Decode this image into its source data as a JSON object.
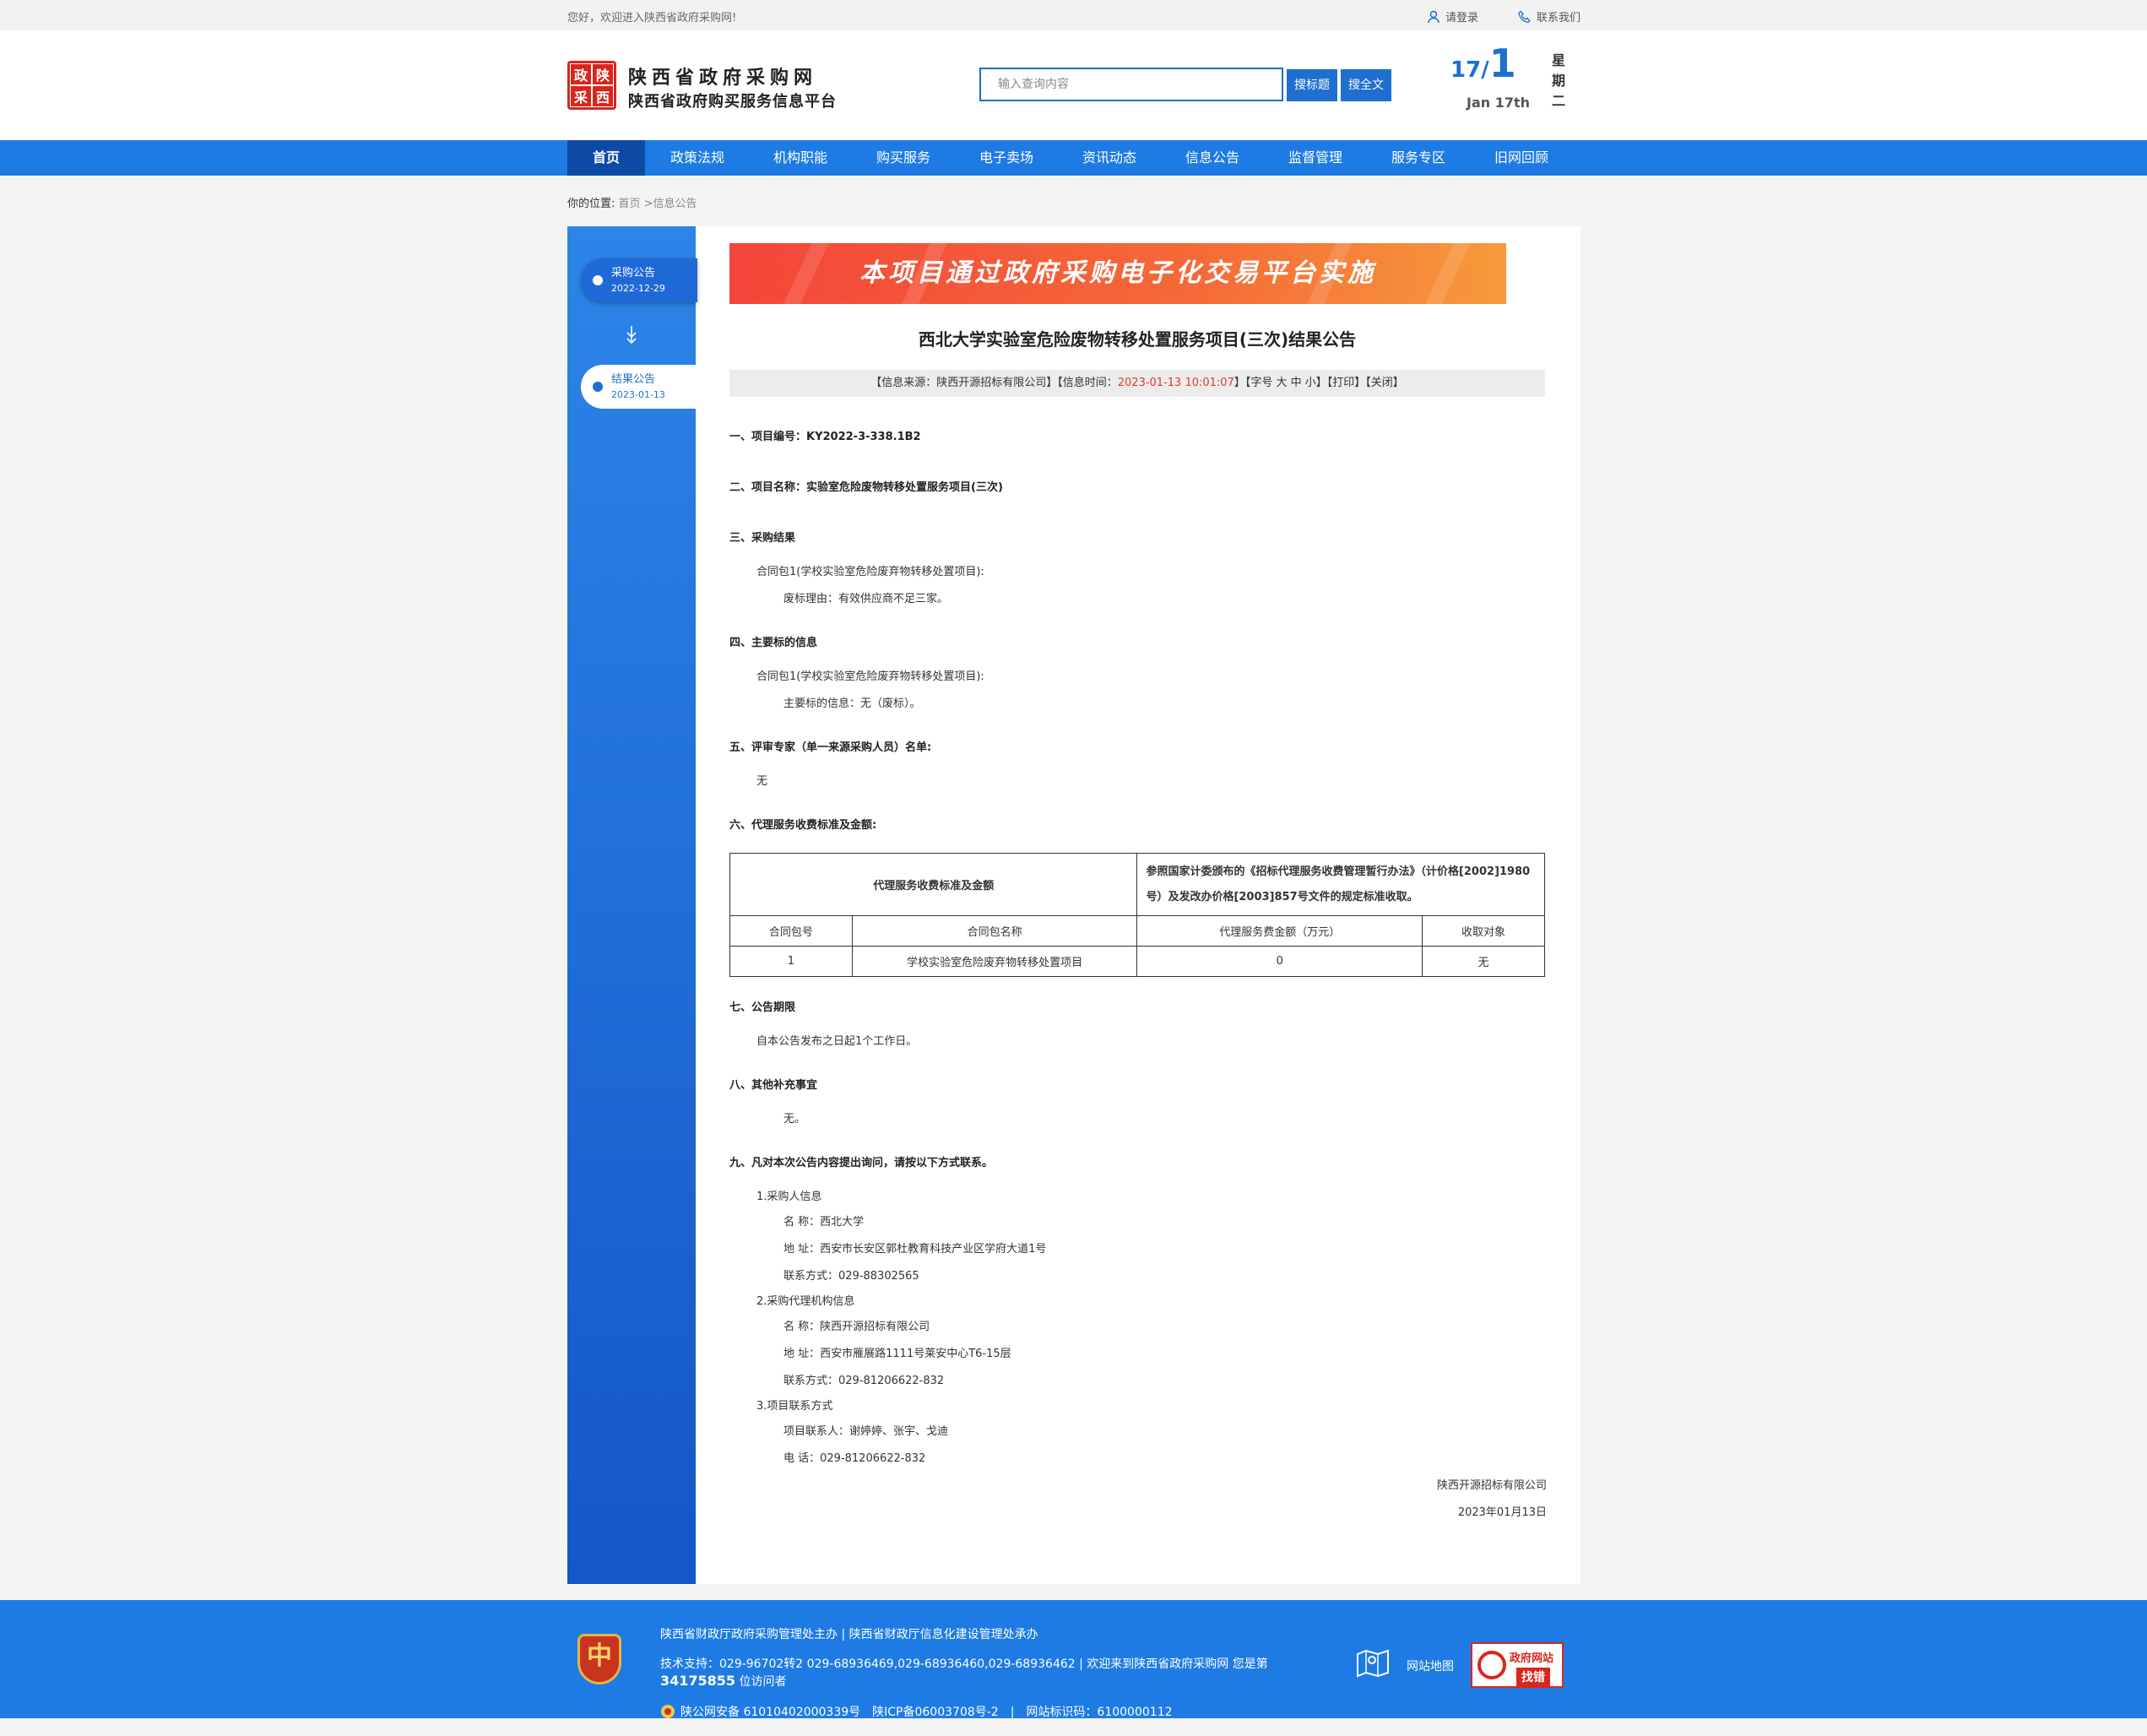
{
  "topbar": {
    "greeting": "您好，欢迎进入陕西省政府采购网!",
    "login": "请登录",
    "contact": "联系我们"
  },
  "header": {
    "logo_chars": [
      "政",
      "陕",
      "采",
      "西"
    ],
    "site_name": "陕西省政府采购网",
    "site_sub": "陕西省政府购买服务信息平台",
    "search_placeholder": "输入查询内容",
    "btn_title": "搜标题",
    "btn_full": "搜全文",
    "date_day": "17",
    "date_slash": "/",
    "date_month": "1",
    "date_en": "Jan 17th",
    "weekday": "星期二"
  },
  "nav": [
    "首页",
    "政策法规",
    "机构职能",
    "购买服务",
    "电子卖场",
    "资讯动态",
    "信息公告",
    "监督管理",
    "服务专区",
    "旧网回顾"
  ],
  "breadcrumb": {
    "label": "你的位置:",
    "path": "首页 >信息公告"
  },
  "timeline": [
    {
      "title": "采购公告",
      "date": "2022-12-29"
    },
    {
      "title": "结果公告",
      "date": "2023-01-13"
    }
  ],
  "banner": "本项目通过政府采购电子化交易平台实施",
  "article": {
    "title": "西北大学实验室危险废物转移处置服务项目(三次)结果公告",
    "info_prefix": "【信息来源：陕西开源招标有限公司】【信息时间：",
    "info_time": "2023-01-13 10:01:07",
    "info_suffix": "】【字号 大 中 小】【打印】【关闭】",
    "s1": "一、项目编号：KY2022-3-338.1B2",
    "s2": "二、项目名称：实验室危险废物转移处置服务项目(三次)",
    "s3": "三、采购结果",
    "s3_pkg": "合同包1(学校实验室危险废弃物转移处置项目):",
    "s3_reason": "废标理由：有效供应商不足三家。",
    "s4": "四、主要标的信息",
    "s4_pkg": "合同包1(学校实验室危险废弃物转移处置项目):",
    "s4_info": "主要标的信息：无（废标）。",
    "s5": "五、评审专家（单一来源采购人员）名单:",
    "s5_val": "无",
    "s6": "六、代理服务收费标准及金额:",
    "s7": "七、公告期限",
    "s7_val": "自本公告发布之日起1个工作日。",
    "s8": "八、其他补充事宜",
    "s8_val": "无。",
    "s9": "九、凡对本次公告内容提出询问，请按以下方式联系。",
    "c1": "1.采购人信息",
    "c1_name": "名  称：西北大学",
    "c1_addr": "地  址：西安市长安区郭杜教育科技产业区学府大道1号",
    "c1_tel": "联系方式：029-88302565",
    "c2": "2.采购代理机构信息",
    "c2_name": "名  称：陕西开源招标有限公司",
    "c2_addr": "地  址：西安市雁展路1111号莱安中心T6-15层",
    "c2_tel": "联系方式：029-81206622-832",
    "c3": "3.项目联系方式",
    "c3_person": "项目联系人：谢婷婷、张宇、戈迪",
    "c3_tel": "电  话：029-81206622-832",
    "sign_org": "陕西开源招标有限公司",
    "sign_date": "2023年01月13日"
  },
  "fee_table": {
    "head_left": "代理服务收费标准及金额",
    "head_right": "参照国家计委颁布的《招标代理服务收费管理暂行办法》（计价格[2002]1980号）及发改办价格[2003]857号文件的规定标准收取。",
    "columns": [
      "合同包号",
      "合同包名称",
      "代理服务费金额（万元）",
      "收取对象"
    ],
    "rows": [
      [
        "1",
        "学校实验室危险废弃物转移处置项目",
        "0",
        "无"
      ]
    ]
  },
  "footer": {
    "emblem": "中",
    "line1": "陕西省财政厅政府采购管理处主办 | 陕西省财政厅信息化建设管理处承办",
    "line2_prefix": "技术支持：029-96702转2 029-68936469,029-68936460,029-68936462 | 欢迎来到陕西省政府采购网 您是第",
    "visits": "34175855",
    "line2_suffix": "位访问者",
    "line3": "陕公网安备 61010402000339号　陕ICP备06003708号-2　|　网站标识码：6100000112",
    "sitemap": "网站地图",
    "badge_top": "政府网站",
    "badge_bottom": "找错"
  }
}
